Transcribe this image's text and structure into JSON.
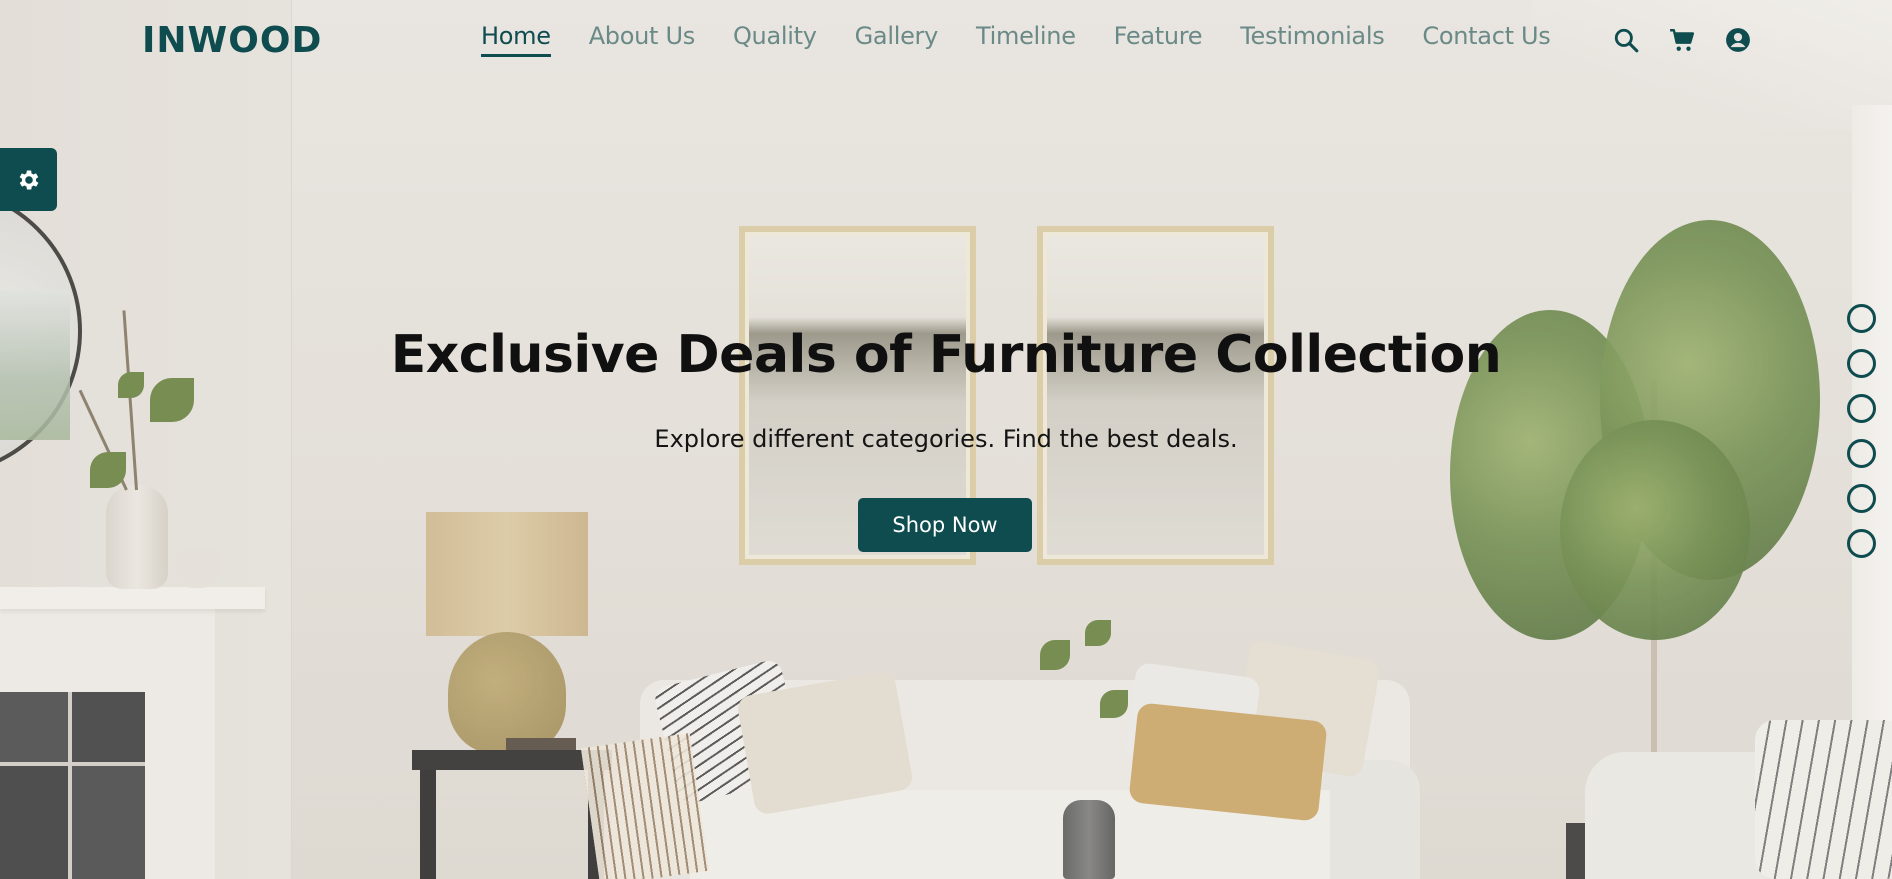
{
  "brand": {
    "logo": "INWOOD",
    "accent_color": "#0e4c4f"
  },
  "nav": {
    "items": [
      {
        "label": "Home",
        "active": true
      },
      {
        "label": "About Us",
        "active": false
      },
      {
        "label": "Quality",
        "active": false
      },
      {
        "label": "Gallery",
        "active": false
      },
      {
        "label": "Timeline",
        "active": false
      },
      {
        "label": "Feature",
        "active": false
      },
      {
        "label": "Testimonials",
        "active": false
      },
      {
        "label": "Contact Us",
        "active": false
      }
    ],
    "icons": [
      "search-icon",
      "cart-icon",
      "user-account-icon"
    ]
  },
  "settings": {
    "icon": "gear-icon"
  },
  "hero": {
    "title": "Exclusive Deals of Furniture Collection",
    "subtitle": "Explore different categories. Find the best deals.",
    "cta_label": "Shop Now"
  },
  "slider": {
    "dot_count": 6
  }
}
